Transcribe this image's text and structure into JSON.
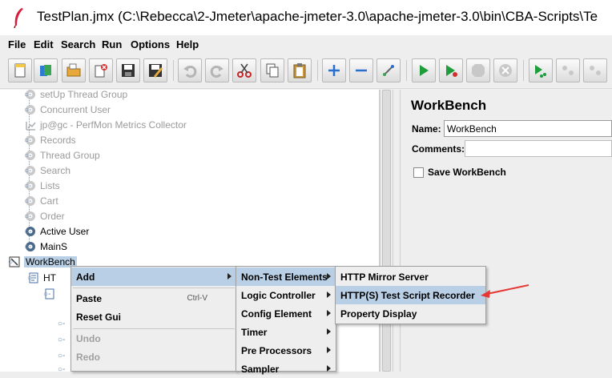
{
  "window": {
    "title": "TestPlan.jmx (C:\\Rebecca\\2-Jmeter\\apache-jmeter-3.0\\apache-jmeter-3.0\\bin\\CBA-Scripts\\Te"
  },
  "menubar": {
    "items": [
      "File",
      "Edit",
      "Search",
      "Run",
      "Options",
      "Help"
    ]
  },
  "toolbar": {
    "icons": [
      "new-icon",
      "templates-icon",
      "open-icon",
      "close-icon",
      "save-icon",
      "save-as-icon",
      "undo-icon",
      "redo-icon",
      "cut-icon",
      "copy-icon",
      "paste-icon",
      "expand-icon",
      "collapse-icon",
      "toggle-icon",
      "start-icon",
      "start-no-pause-icon",
      "stop-icon",
      "shutdown-icon",
      "remote-start-icon",
      "remote-stop-icon",
      "remote-shutdown-icon"
    ]
  },
  "tree": {
    "nodes": [
      {
        "label": "setUp Thread Group",
        "disabled": true
      },
      {
        "label": "Concurrent User",
        "disabled": true
      },
      {
        "label": "jp@gc - PerfMon Metrics Collector",
        "disabled": true
      },
      {
        "label": "Records",
        "disabled": true
      },
      {
        "label": "Thread Group",
        "disabled": true
      },
      {
        "label": "Search",
        "disabled": true
      },
      {
        "label": "Lists",
        "disabled": true
      },
      {
        "label": "Cart",
        "disabled": true
      },
      {
        "label": "Order",
        "disabled": true
      },
      {
        "label": "Active User",
        "disabled": false
      },
      {
        "label": "MainS",
        "disabled": false
      }
    ],
    "workbench": "WorkBench",
    "child_partial": "HT"
  },
  "panel": {
    "title": "WorkBench",
    "name_label": "Name:",
    "name_value": "WorkBench",
    "comments_label": "Comments:",
    "save_label": "Save WorkBench"
  },
  "context_menu": {
    "add": "Add",
    "paste": "Paste",
    "paste_accel": "Ctrl-V",
    "reset_gui": "Reset Gui",
    "undo": "Undo",
    "redo": "Redo"
  },
  "submenu_add": [
    "Non-Test Elements",
    "Logic Controller",
    "Config Element",
    "Timer",
    "Pre Processors",
    "Sampler"
  ],
  "submenu_nontest": [
    "HTTP Mirror Server",
    "HTTP(S) Test Script Recorder",
    "Property Display"
  ],
  "colors": {
    "selection": "#b8cfe5",
    "annotation_arrow": "#e53935",
    "start_green": "#1e9e3a"
  }
}
